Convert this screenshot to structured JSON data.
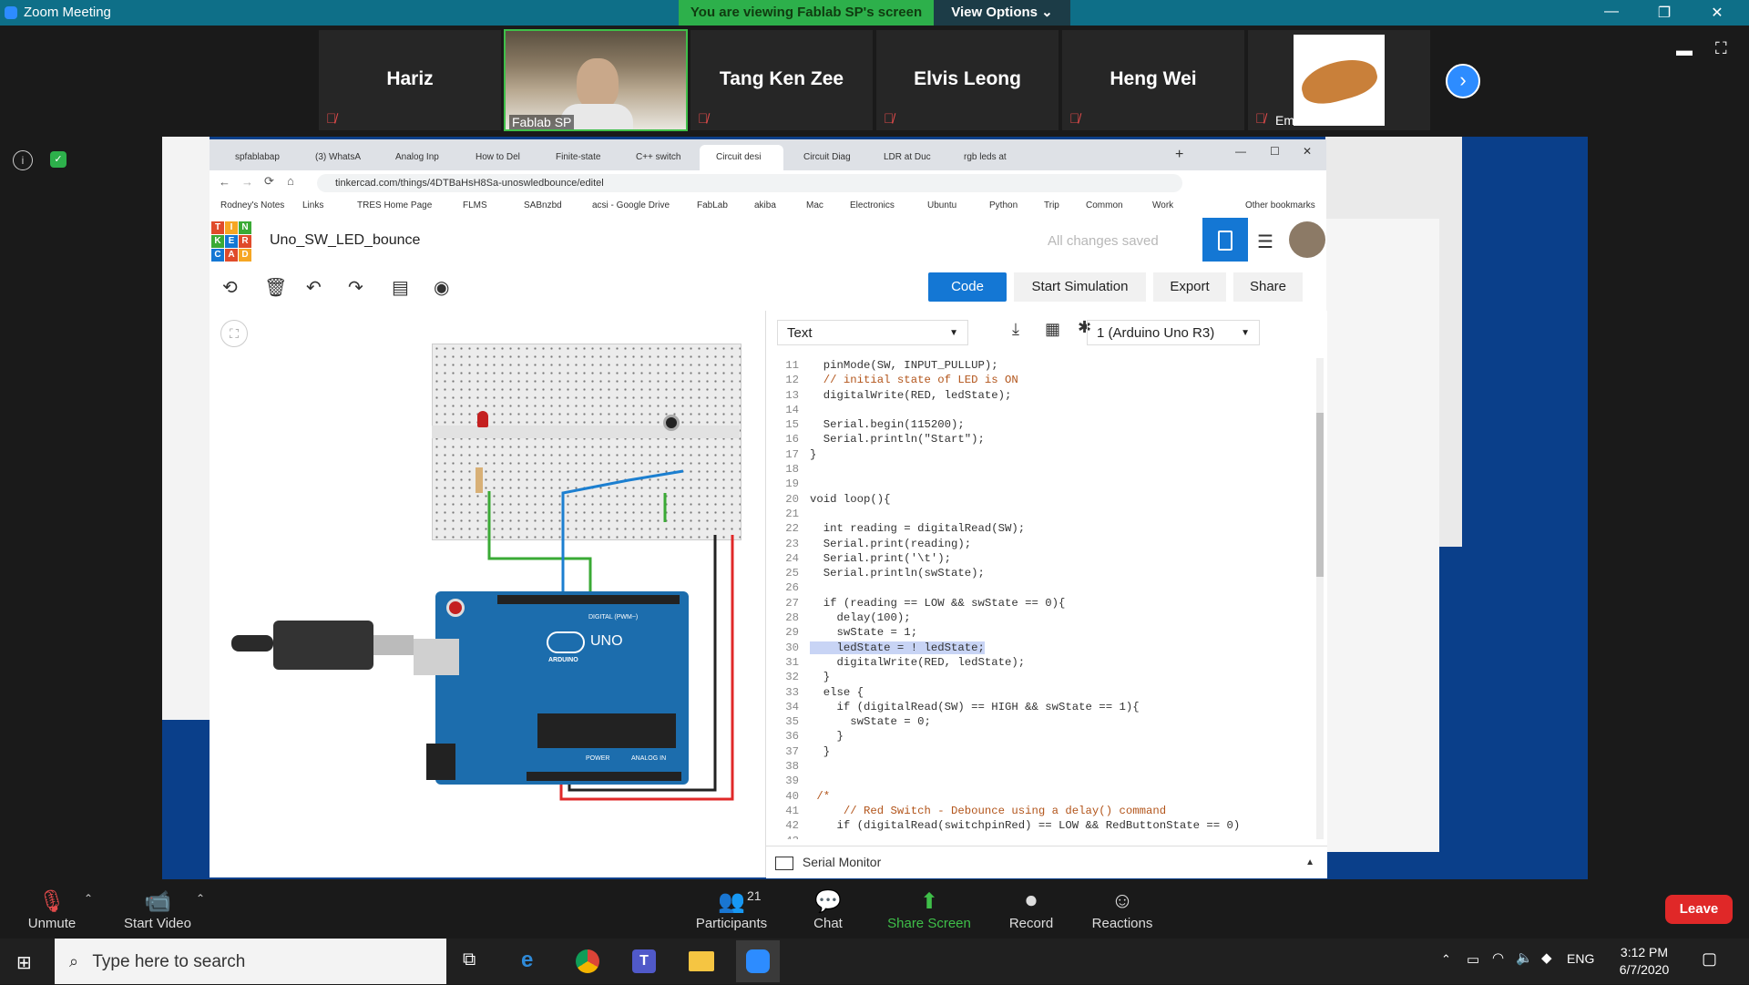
{
  "zoom": {
    "window_title": "Zoom Meeting",
    "viewing_banner": "You are viewing Fablab SP's screen",
    "view_options": "View Options ⌄",
    "participants": [
      "Hariz",
      "Fablab SP",
      "Tang Ken Zee",
      "Elvis Leong",
      "Heng Wei",
      "Emmanuel Ch..."
    ],
    "controls": {
      "unmute": "Unmute",
      "start_video": "Start Video",
      "participants": "Participants",
      "participants_count": "21",
      "chat": "Chat",
      "share_screen": "Share Screen",
      "record": "Record",
      "reactions": "Reactions",
      "leave": "Leave"
    }
  },
  "browser": {
    "tabs": [
      "spfablabap",
      "(3) WhatsA",
      "Analog Inp",
      "How to Del",
      "Finite-state",
      "C++ switch",
      "Circuit desi",
      "Circuit Diag",
      "LDR at Duc",
      "rgb leds at"
    ],
    "url": "tinkercad.com/things/4DTBaHsH8Sa-unoswledbounce/editel",
    "bookmarks": [
      "Rodney's Notes",
      "Links",
      "TRES Home Page",
      "FLMS",
      "SABnzbd",
      "acsi - Google Drive",
      "FabLab",
      "akiba",
      "Mac",
      "Electronics",
      "Ubuntu",
      "Python",
      "Trip",
      "Common",
      "Work",
      "Other bookmarks"
    ]
  },
  "tinkercad": {
    "design_title": "Uno_SW_LED_bounce",
    "save_status": "All changes saved",
    "code_button": "Code",
    "start_simulation": "Start Simulation",
    "export": "Export",
    "share": "Share",
    "code_mode": "Text",
    "board": "1 (Arduino Uno R3)",
    "serial_monitor": "Serial Monitor",
    "code_lines": [
      {
        "n": "11",
        "t": "  pinMode(SW, INPUT_PULLUP);"
      },
      {
        "n": "12",
        "t": "  // initial state of LED is ON"
      },
      {
        "n": "13",
        "t": "  digitalWrite(RED, ledState);"
      },
      {
        "n": "14",
        "t": ""
      },
      {
        "n": "15",
        "t": "  Serial.begin(115200);"
      },
      {
        "n": "16",
        "t": "  Serial.println(\"Start\");"
      },
      {
        "n": "17",
        "t": "}"
      },
      {
        "n": "18",
        "t": ""
      },
      {
        "n": "19",
        "t": ""
      },
      {
        "n": "20",
        "t": "void loop(){"
      },
      {
        "n": "21",
        "t": ""
      },
      {
        "n": "22",
        "t": "  int reading = digitalRead(SW);"
      },
      {
        "n": "23",
        "t": "  Serial.print(reading);"
      },
      {
        "n": "24",
        "t": "  Serial.print('\\t');"
      },
      {
        "n": "25",
        "t": "  Serial.println(swState);"
      },
      {
        "n": "26",
        "t": ""
      },
      {
        "n": "27",
        "t": "  if (reading == LOW && swState == 0){"
      },
      {
        "n": "28",
        "t": "    delay(100);"
      },
      {
        "n": "29",
        "t": "    swState = 1;"
      },
      {
        "n": "30",
        "t": "    ledState = ! ledState;"
      },
      {
        "n": "31",
        "t": "    digitalWrite(RED, ledState);"
      },
      {
        "n": "32",
        "t": "  }"
      },
      {
        "n": "33",
        "t": "  else {"
      },
      {
        "n": "34",
        "t": "    if (digitalRead(SW) == HIGH && swState == 1){"
      },
      {
        "n": "35",
        "t": "      swState = 0;"
      },
      {
        "n": "36",
        "t": "    }"
      },
      {
        "n": "37",
        "t": "  }"
      },
      {
        "n": "38",
        "t": ""
      },
      {
        "n": "39",
        "t": ""
      },
      {
        "n": "40",
        "t": " /*"
      },
      {
        "n": "41",
        "t": "     // Red Switch - Debounce using a delay() command"
      },
      {
        "n": "42",
        "t": "    if (digitalRead(switchpinRed) == LOW && RedButtonState == 0)"
      },
      {
        "n": "43",
        "t": ""
      }
    ],
    "arduino_labels": {
      "uno": "UNO",
      "brand": "ARDUINO",
      "digital": "DIGITAL (PWM~)",
      "power": "POWER",
      "analog": "ANALOG IN"
    }
  },
  "taskbar": {
    "search_placeholder": "Type here to search",
    "lang": "ENG",
    "time": "3:12 PM",
    "date": "6/7/2020"
  },
  "colors": {
    "zoom_teal": "#0e6f88",
    "banner_green": "#2db04b",
    "tinkercad_blue": "#1477d4",
    "leave_red": "#e02828"
  }
}
